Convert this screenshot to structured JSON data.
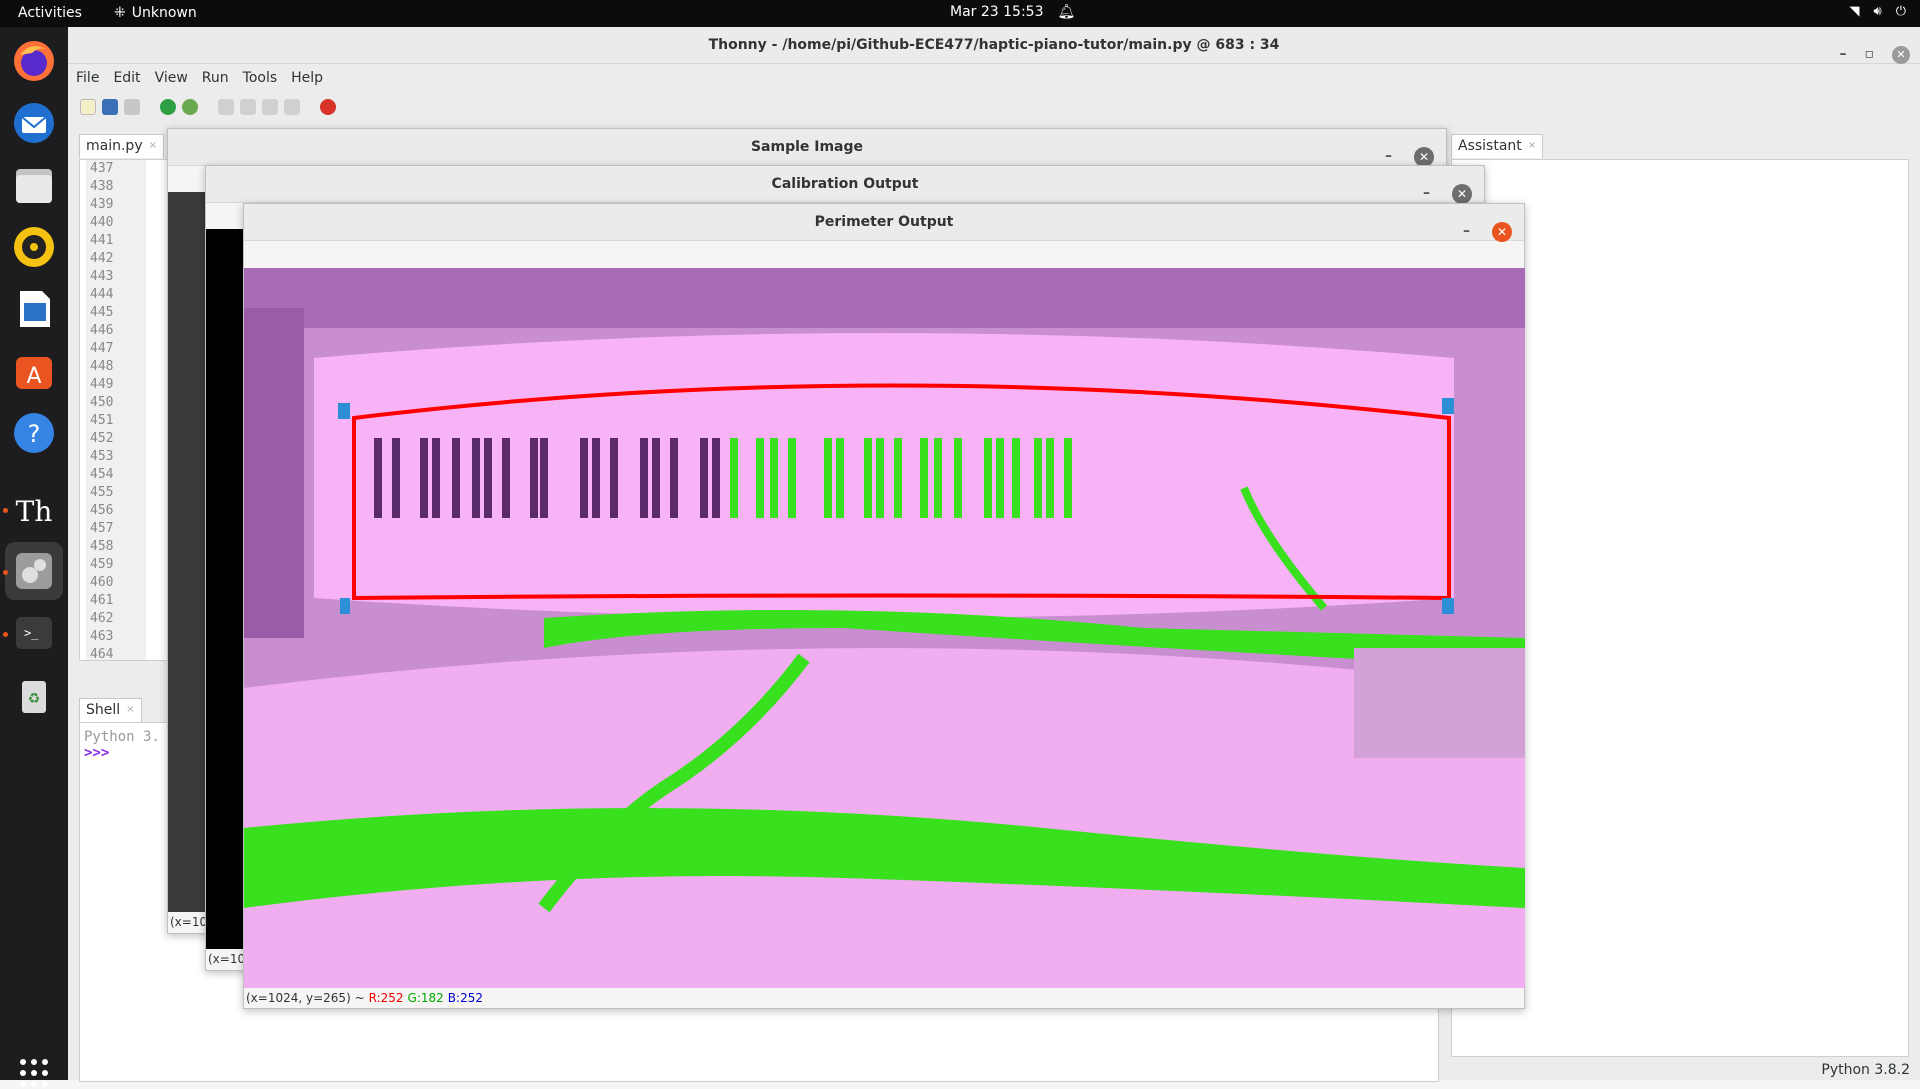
{
  "topbar": {
    "activities": "Activities",
    "app_name": "Unknown",
    "datetime": "Mar 23  15:53"
  },
  "dock": {
    "apps": [
      "firefox-icon",
      "thunderbird-icon",
      "files-icon",
      "rhythmbox-icon",
      "writer-icon",
      "software-center-icon",
      "help-icon",
      "thonny-icon",
      "settings-icon",
      "terminal-icon",
      "trash-icon"
    ]
  },
  "thonny": {
    "title": "Thonny  -  /home/pi/Github-ECE477/haptic-piano-tutor/main.py  @  683 : 34",
    "menu": [
      "File",
      "Edit",
      "View",
      "Run",
      "Tools",
      "Help"
    ],
    "editor_tab": "main.py",
    "line_numbers": [
      "437",
      "438",
      "439",
      "440",
      "441",
      "442",
      "443",
      "444",
      "445",
      "446",
      "447",
      "448",
      "449",
      "450",
      "451",
      "452",
      "453",
      "454",
      "455",
      "456",
      "457",
      "458",
      "459",
      "460",
      "461",
      "462",
      "463",
      "464"
    ],
    "shell_tab": "Shell",
    "shell_text": "Python 3.",
    "shell_prompt": ">>>",
    "assistant_tab": "Assistant",
    "status": "Python 3.8.2"
  },
  "windows": {
    "sample": {
      "title": "Sample Image",
      "coord": "(x=10"
    },
    "calibration": {
      "title": "Calibration Output",
      "coord": "(x=10"
    },
    "perimeter": {
      "title": "Perimeter Output",
      "coord_prefix": "(x=1024, y=265) ~",
      "r": "R:252",
      "g": "G:182",
      "b": "B:252"
    }
  },
  "colors": {
    "accent": "#e95420",
    "pink": "#f7b3f5",
    "green": "#39e01e",
    "outline": "#ff0000",
    "marker": "#2d8fd6"
  }
}
